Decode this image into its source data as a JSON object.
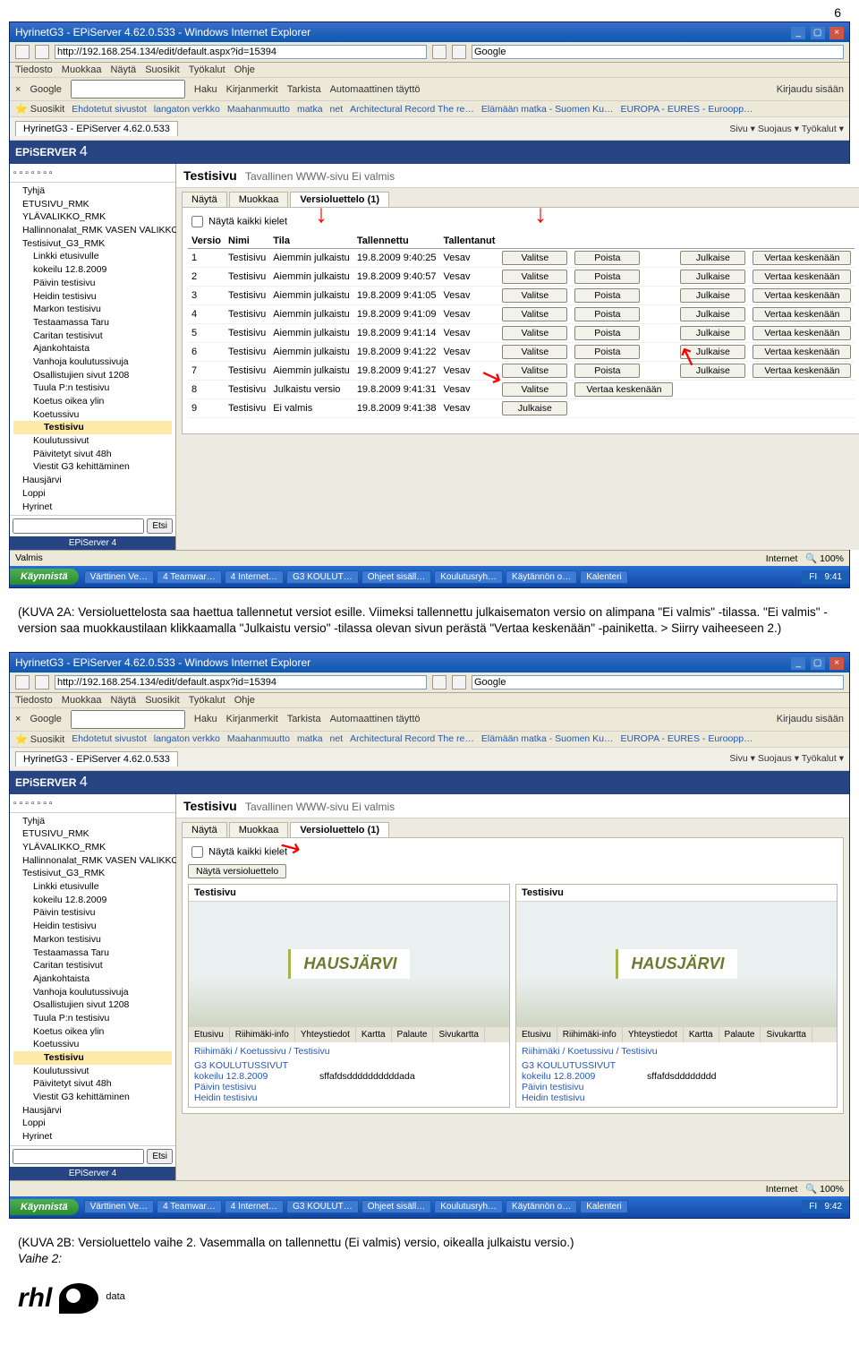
{
  "page_number": "6",
  "caption1": "(KUVA 2A: Versioluettelosta saa haettua tallennetut versiot esille. Viimeksi tallennettu julkaisematon versio on alimpana \"Ei valmis\" -tilassa. \"Ei valmis\" -version saa muokkaustilaan klikkaamalla \"Julkaistu versio\" -tilassa olevan sivun perästä \"Vertaa keskenään\" -painiketta. > Siirry vaiheeseen 2.)",
  "caption2": "(KUVA 2B: Versioluettelo vaihe 2. Vasemmalla on tallennettu (Ei valmis) versio, oikealla julkaistu versio.)",
  "caption2_extra": "Vaihe 2:",
  "browser": {
    "title": "HyrinetG3 - EPiServer 4.62.0.533 - Windows Internet Explorer",
    "url": "http://192.168.254.134/edit/default.aspx?id=15394",
    "url2": "http://192.168.254.134/edit/default.aspx?id=15394",
    "search_engine": "Google",
    "menu": [
      "Tiedosto",
      "Muokkaa",
      "Näytä",
      "Suosikit",
      "Työkalut",
      "Ohje"
    ],
    "google_bar": [
      "Google",
      "Haku",
      "Kirjanmerkit",
      "Tarkista",
      "Automaattinen täyttö",
      "Kirjaudu sisään"
    ],
    "fav_label": "Suosikit",
    "favorites": [
      "Ehdotetut sivustot",
      "langaton verkko",
      "Maahanmuutto",
      "matka",
      "net",
      "Architectural Record The re…",
      "Elämään matka - Suomen Ku…",
      "EUROPA - EURES - Euroopp…"
    ],
    "tab": "HyrinetG3 - EPiServer 4.62.0.533",
    "right_tools": "Sivu ▾  Suojaus ▾  Työkalut ▾",
    "status_right": "Internet",
    "zoom": "100%"
  },
  "epi": {
    "brand": "EPiSERVER",
    "brand_v": "4",
    "page_title": "Testisivu",
    "page_sub": "Tavallinen WWW-sivu  Ei valmis",
    "tabs": [
      "Näytä",
      "Muokkaa",
      "Versioluettelo (1)"
    ],
    "search_btn": "Etsi",
    "footer": "EPiServer 4",
    "check_all_lang": "Näytä kaikki kielet",
    "show_verlist_btn": "Näytä versioluettelo",
    "tree": [
      "Tyhjä",
      "ETUSIVU_RMK",
      "YLÄVALIKKO_RMK",
      "Hallinnonalat_RMK VASEN VALIKKO",
      "Testisivut_G3_RMK",
      "Linkki etusivulle",
      "kokeilu 12.8.2009",
      "Päivin testisivu",
      "Heidin testisivu",
      "Markon testisivu",
      "Testaamassa Taru",
      "Caritan testisivut",
      "Ajankohtaista",
      "Vanhoja koulutussivuja",
      "Osallistujien sivut 1208",
      "Tuula P:n testisivu",
      "Koetus oikea ylin",
      "Koetussivu",
      "Testisivu",
      "Koulutussivut",
      "Päivitetyt sivut 48h",
      "Viestit G3 kehittäminen",
      "Hausjärvi",
      "Loppi",
      "Hyrinet"
    ]
  },
  "vertable": {
    "headers": [
      "Versio",
      "Nimi",
      "Tila",
      "Tallennettu",
      "Tallentanut"
    ],
    "rows": [
      {
        "v": "1",
        "n": "Testisivu",
        "t": "Aiemmin julkaistu",
        "d": "19.8.2009 9:40:25",
        "u": "Vesav",
        "a": [
          "Valitse",
          "Poista",
          "Julkaise",
          "Vertaa keskenään"
        ]
      },
      {
        "v": "2",
        "n": "Testisivu",
        "t": "Aiemmin julkaistu",
        "d": "19.8.2009 9:40:57",
        "u": "Vesav",
        "a": [
          "Valitse",
          "Poista",
          "Julkaise",
          "Vertaa keskenään"
        ]
      },
      {
        "v": "3",
        "n": "Testisivu",
        "t": "Aiemmin julkaistu",
        "d": "19.8.2009 9:41:05",
        "u": "Vesav",
        "a": [
          "Valitse",
          "Poista",
          "Julkaise",
          "Vertaa keskenään"
        ]
      },
      {
        "v": "4",
        "n": "Testisivu",
        "t": "Aiemmin julkaistu",
        "d": "19.8.2009 9:41:09",
        "u": "Vesav",
        "a": [
          "Valitse",
          "Poista",
          "Julkaise",
          "Vertaa keskenään"
        ]
      },
      {
        "v": "5",
        "n": "Testisivu",
        "t": "Aiemmin julkaistu",
        "d": "19.8.2009 9:41:14",
        "u": "Vesav",
        "a": [
          "Valitse",
          "Poista",
          "Julkaise",
          "Vertaa keskenään"
        ]
      },
      {
        "v": "6",
        "n": "Testisivu",
        "t": "Aiemmin julkaistu",
        "d": "19.8.2009 9:41:22",
        "u": "Vesav",
        "a": [
          "Valitse",
          "Poista",
          "Julkaise",
          "Vertaa keskenään"
        ]
      },
      {
        "v": "7",
        "n": "Testisivu",
        "t": "Aiemmin julkaistu",
        "d": "19.8.2009 9:41:27",
        "u": "Vesav",
        "a": [
          "Valitse",
          "Poista",
          "Julkaise",
          "Vertaa keskenään"
        ]
      },
      {
        "v": "8",
        "n": "Testisivu",
        "t": "Julkaistu versio",
        "d": "19.8.2009 9:41:31",
        "u": "Vesav",
        "a": [
          "Valitse",
          "Vertaa keskenään"
        ]
      },
      {
        "v": "9",
        "n": "Testisivu",
        "t": "Ei valmis",
        "d": "19.8.2009 9:41:38",
        "u": "Vesav",
        "a": [
          "Julkaise"
        ]
      }
    ]
  },
  "compare": {
    "col_title": "Testisivu",
    "preview_logo": "HAUSJÄRVI",
    "nav": [
      "Etusivu",
      "Riihimäki-info",
      "Yhteystiedot",
      "Kartta",
      "Palaute",
      "Sivukartta"
    ],
    "bc": "Riihimäki / Koetussivu /   Testisivu",
    "left_rows": [
      {
        "l": "G3 KOULUTUSSIVUT",
        "r": ""
      },
      {
        "l": "kokeilu 12.8.2009",
        "r": "sffafdsddddddddddada"
      },
      {
        "l": "Päivin testisivu",
        "r": ""
      },
      {
        "l": "Heidin testisivu",
        "r": ""
      }
    ],
    "right_rows": [
      {
        "l": "G3 KOULUTUSSIVUT",
        "r": ""
      },
      {
        "l": "kokeilu 12.8.2009",
        "r": "sffafdsdddddddd"
      },
      {
        "l": "Päivin testisivu",
        "r": ""
      },
      {
        "l": "Heidin testisivu",
        "r": ""
      }
    ]
  },
  "taskbar": {
    "start": "Käynnistä",
    "tasks": [
      "Värttinen Ve…",
      "4 Teamwar…",
      "4 Internet…",
      "G3 KOULUT…",
      "Ohjeet sisäll…",
      "Koulutusryh…",
      "Käytännön o…",
      "Kalenteri"
    ],
    "lang": "FI",
    "time1": "9:41",
    "time2": "9:42"
  },
  "logo": {
    "name": "rhl",
    "sub": "data"
  }
}
